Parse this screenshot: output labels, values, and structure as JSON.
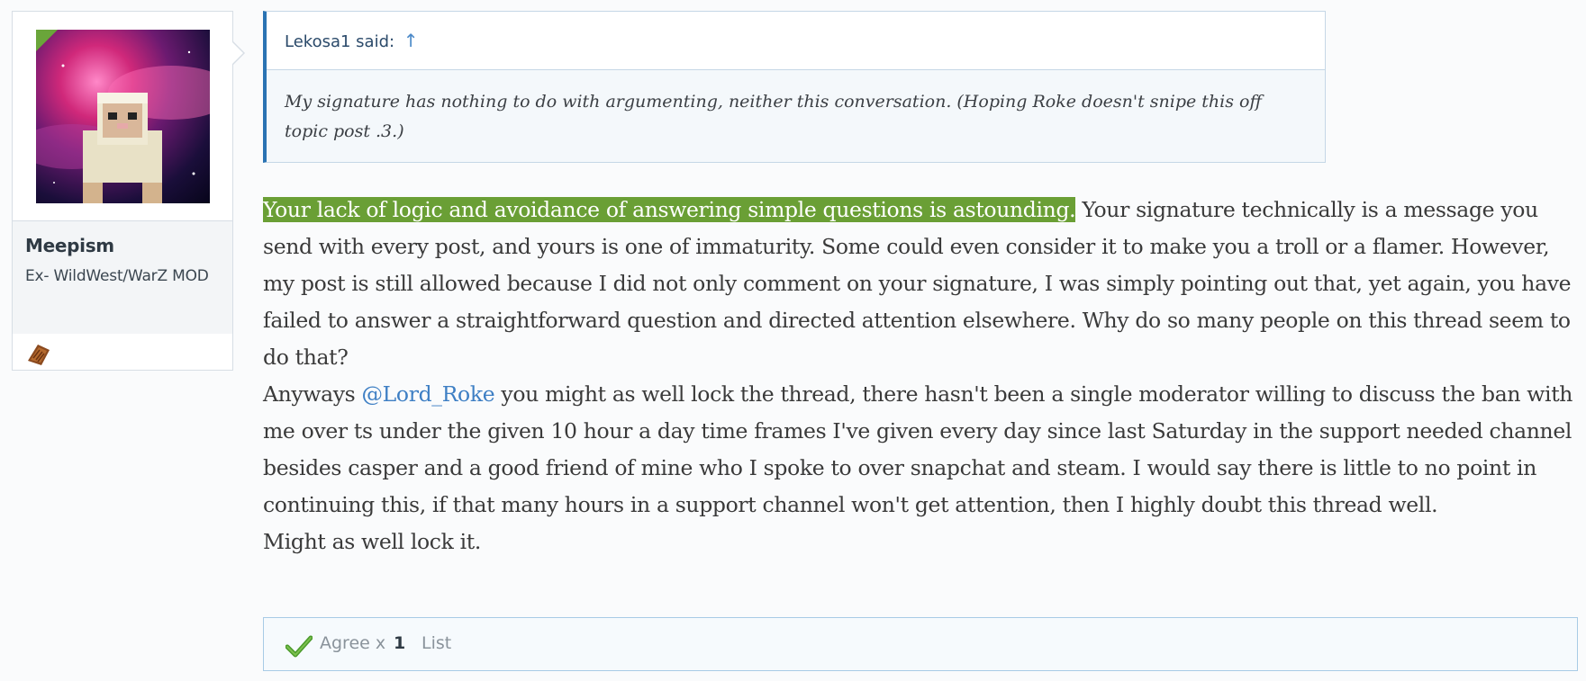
{
  "user": {
    "name": "Meepism",
    "title": "Ex- WildWest/WarZ MOD",
    "avatar_icon": "sheep-avatar-icon",
    "trophy_icon": "trophy-badge-icon"
  },
  "quote": {
    "author": "Lekosa1 said:",
    "jump_arrow": "↑",
    "text": "My signature has nothing to do with argumenting, neither this conversation. (Hoping Roke doesn't snipe this off topic post .3.)"
  },
  "message": {
    "highlighted": "Your lack of logic and avoidance of answering simple questions is astounding.",
    "para1_rest": " Your signature technically is a message you send with every post, and yours is one of immaturity. Some could even consider it to make you a troll or a flamer. However, my post is still allowed because I did not only comment on your signature, I was simply pointing out that, yet again, you have failed to answer a straightforward question and directed attention elsewhere. Why do so many people on this thread seem to do that?",
    "para2_prefix": "Anyways ",
    "mention": "@Lord_Roke",
    "para2_rest": " you might as well lock the thread, there hasn't been a single moderator willing to discuss the ban with me over ts under the given 10 hour a day time frames I've given every day since last Saturday in the support needed channel besides casper and a good friend of mine who I spoke to over snapchat and steam. I would say there is little to no point in continuing this, if that many hours in a support channel won't get attention, then I highly doubt this thread well.",
    "para3": "Might as well lock it."
  },
  "likes": {
    "icon": "checkmark-icon",
    "label": "Agree x",
    "count": "1",
    "list_label": "List"
  },
  "colors": {
    "highlight_bg": "#6a9f35",
    "mention": "#3e7fc4",
    "quote_accent": "#2a73b3",
    "flag": "#6aa53a"
  }
}
